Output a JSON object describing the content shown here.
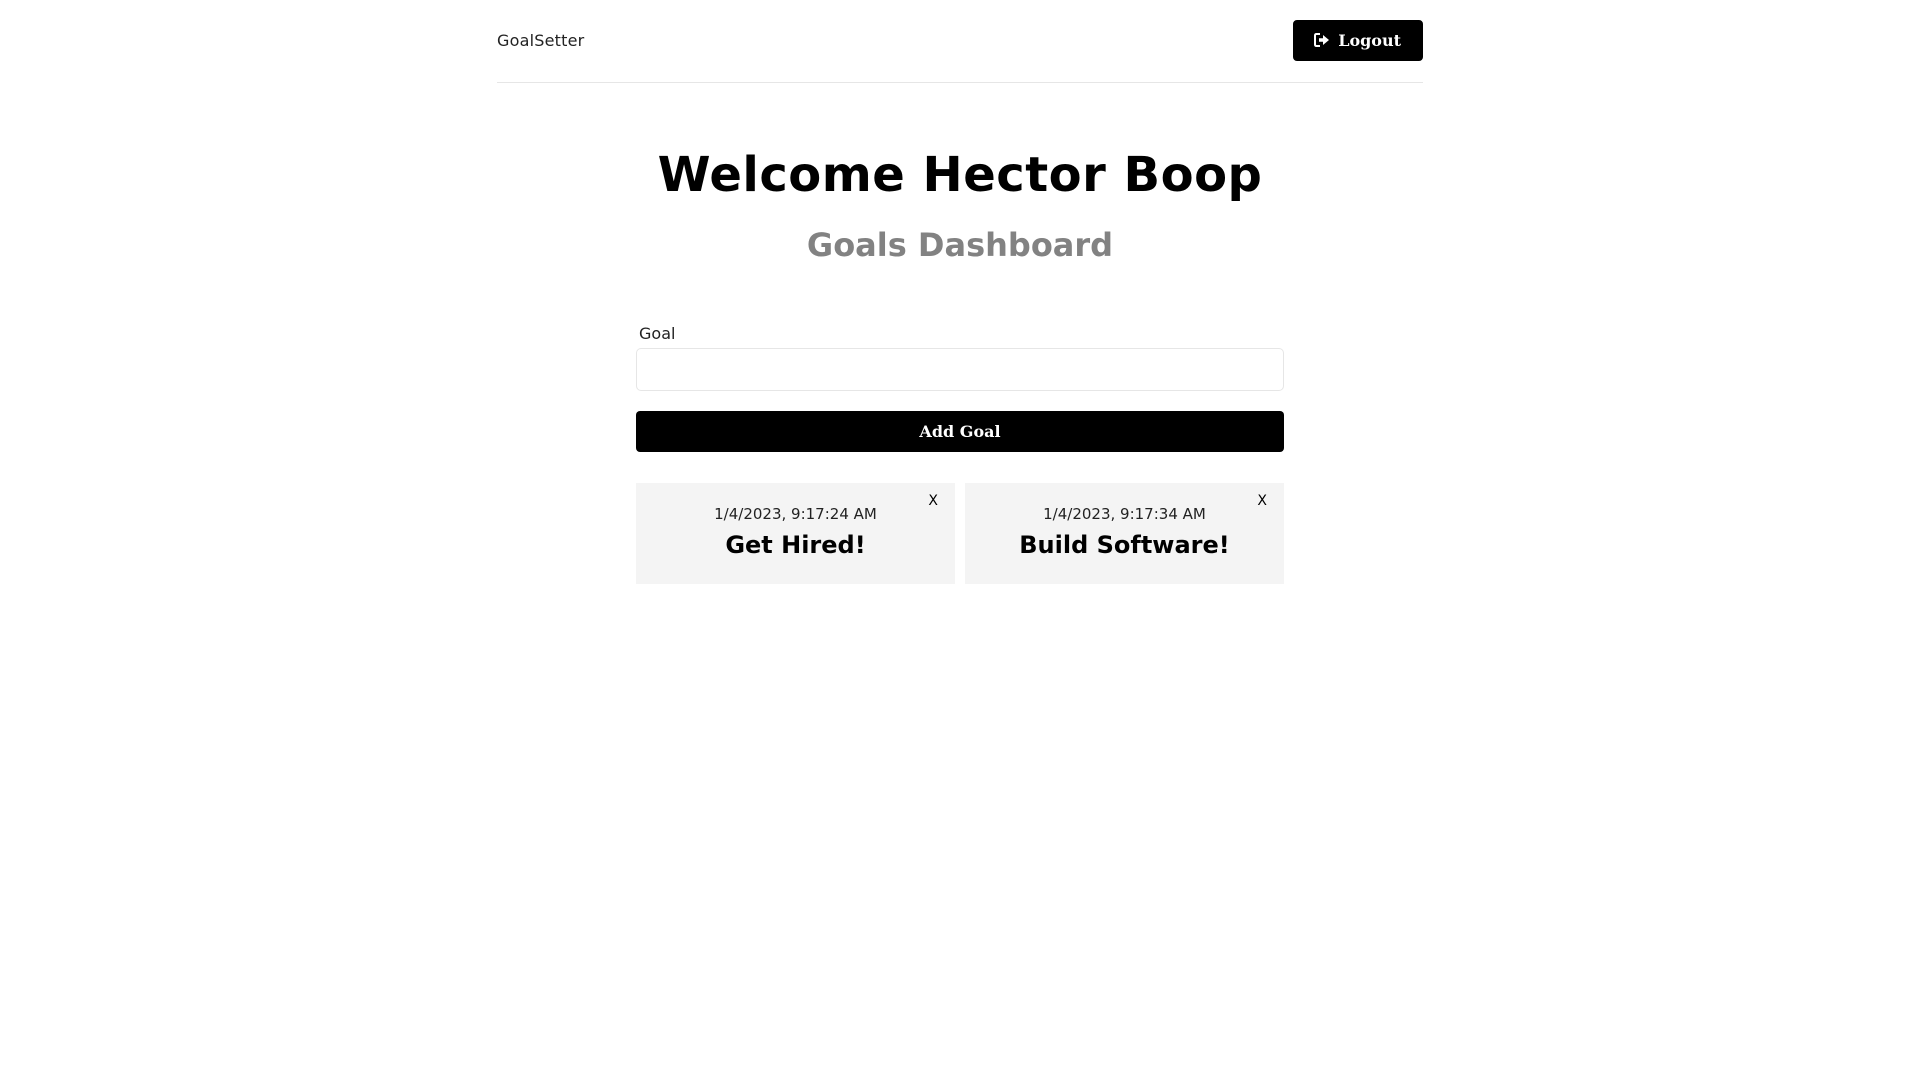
{
  "header": {
    "logo": "GoalSetter",
    "logout_label": "Logout"
  },
  "heading": {
    "welcome": "Welcome Hector Boop",
    "subtitle": "Goals Dashboard"
  },
  "form": {
    "label": "Goal",
    "input_value": "",
    "input_placeholder": "",
    "submit_label": "Add Goal"
  },
  "goals": [
    {
      "date": "1/4/2023, 9:17:24 AM",
      "text": "Get Hired!",
      "close_label": "X"
    },
    {
      "date": "1/4/2023, 9:17:34 AM",
      "text": "Build Software!",
      "close_label": "X"
    }
  ],
  "colors": {
    "primary": "#000000",
    "subtitle": "#828282",
    "card_background": "#f4f4f4",
    "divider": "#e6e6e6"
  },
  "icons": {
    "logout": "sign-out-icon"
  }
}
